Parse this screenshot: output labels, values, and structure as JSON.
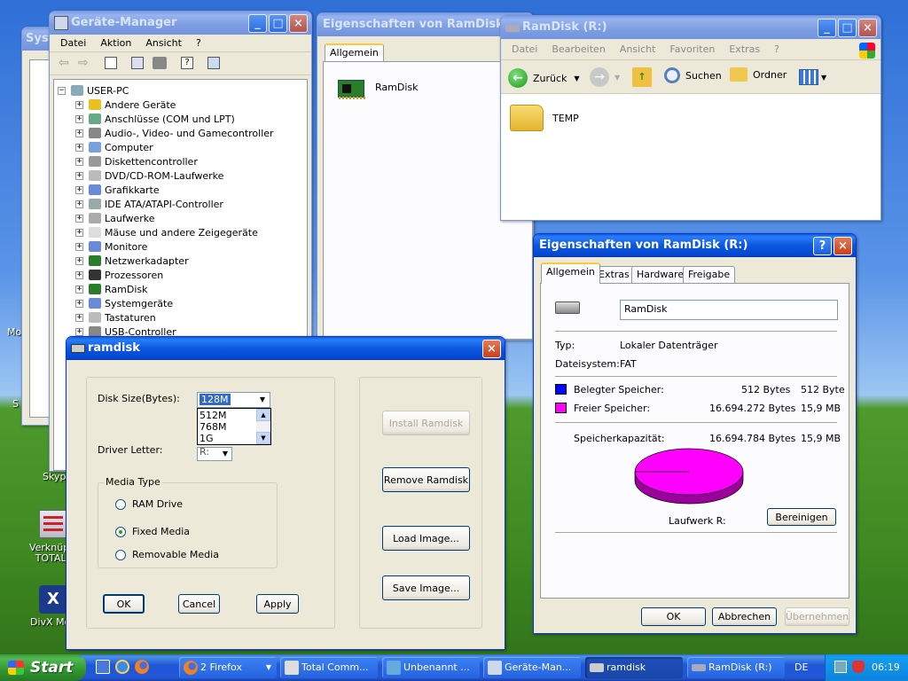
{
  "desktop": {
    "icons": [
      {
        "label": "Verknüpfu TOTALC"
      },
      {
        "label": "DivX Mo"
      }
    ],
    "partial_labels": {
      "skype": "Skyp",
      "mo": "Mo",
      "s": "S"
    }
  },
  "system_window": {
    "title": "Syste"
  },
  "device_manager": {
    "title": "Geräte-Manager",
    "menu": [
      "Datei",
      "Aktion",
      "Ansicht",
      "?"
    ],
    "root": "USER-PC",
    "items": [
      {
        "label": "Andere Geräte",
        "icon": "question-icon"
      },
      {
        "label": "Anschlüsse (COM und LPT)",
        "icon": "port-icon"
      },
      {
        "label": "Audio-, Video- und Gamecontroller",
        "icon": "audio-icon"
      },
      {
        "label": "Computer",
        "icon": "computer-icon"
      },
      {
        "label": "Diskettencontroller",
        "icon": "floppy-icon"
      },
      {
        "label": "DVD/CD-ROM-Laufwerke",
        "icon": "cdrom-icon"
      },
      {
        "label": "Grafikkarte",
        "icon": "display-icon"
      },
      {
        "label": "IDE ATA/ATAPI-Controller",
        "icon": "ide-icon"
      },
      {
        "label": "Laufwerke",
        "icon": "drive-icon"
      },
      {
        "label": "Mäuse und andere Zeigegeräte",
        "icon": "mouse-icon"
      },
      {
        "label": "Monitore",
        "icon": "monitor-icon"
      },
      {
        "label": "Netzwerkadapter",
        "icon": "network-icon"
      },
      {
        "label": "Prozessoren",
        "icon": "cpu-icon"
      },
      {
        "label": "RamDisk",
        "icon": "ramdisk-icon"
      },
      {
        "label": "Systemgeräte",
        "icon": "system-icon"
      },
      {
        "label": "Tastaturen",
        "icon": "keyboard-icon"
      },
      {
        "label": "USB-Controller",
        "icon": "usb-icon"
      }
    ]
  },
  "ramdisk_props_back": {
    "title": "Eigenschaften von RamDisk",
    "tab": "Allgemein",
    "device": "RamDisk"
  },
  "explorer": {
    "title": "RamDisk (R:)",
    "menu": [
      "Datei",
      "Bearbeiten",
      "Ansicht",
      "Favoriten",
      "Extras",
      "?"
    ],
    "back": "Zurück",
    "search": "Suchen",
    "folders": "Ordner",
    "items": [
      {
        "label": "TEMP"
      }
    ]
  },
  "drive_props": {
    "title": "Eigenschaften von RamDisk (R:)",
    "tabs": [
      "Allgemein",
      "Extras",
      "Hardware",
      "Freigabe"
    ],
    "name_value": "RamDisk",
    "type_label": "Typ:",
    "type_value": "Lokaler Datenträger",
    "fs_label": "Dateisystem:",
    "fs_value": "FAT",
    "used_label": "Belegter Speicher:",
    "used_bytes": "512 Bytes",
    "used_short": "512 Byte",
    "free_label": "Freier Speicher:",
    "free_bytes": "16.694.272 Bytes",
    "free_short": "15,9 MB",
    "cap_label": "Speicherkapazität:",
    "cap_bytes": "16.694.784 Bytes",
    "cap_short": "15,9 MB",
    "drive_label": "Laufwerk R:",
    "cleanup": "Bereinigen",
    "ok": "OK",
    "cancel": "Abbrechen",
    "apply": "Übernehmen",
    "used_fraction": 3.07e-05,
    "colors": {
      "used": "#0000ff",
      "free": "#ff00ff"
    }
  },
  "ramdisk_dialog": {
    "title": "ramdisk",
    "disk_size_label": "Disk Size(Bytes):",
    "disk_size_value": "128M",
    "size_options": [
      "512M",
      "768M",
      "1G"
    ],
    "driver_letter_label": "Driver Letter:",
    "driver_letter_value": "R:",
    "media_type_label": "Media Type",
    "media_options": [
      {
        "label": "RAM Drive",
        "selected": false
      },
      {
        "label": "Fixed Media",
        "selected": true
      },
      {
        "label": "Removable Media",
        "selected": false
      }
    ],
    "ok": "OK",
    "cancel": "Cancel",
    "apply": "Apply",
    "install": "Install Ramdisk",
    "remove": "Remove Ramdisk",
    "load": "Load Image...",
    "save": "Save Image..."
  },
  "taskbar": {
    "start": "Start",
    "items": [
      {
        "label": "2 Firefox"
      },
      {
        "label": "Total Comm..."
      },
      {
        "label": "Unbenannt ..."
      },
      {
        "label": "Geräte-Man..."
      },
      {
        "label": "ramdisk"
      },
      {
        "label": "RamDisk (R:)"
      }
    ],
    "lang": "DE",
    "clock": "06:19"
  }
}
